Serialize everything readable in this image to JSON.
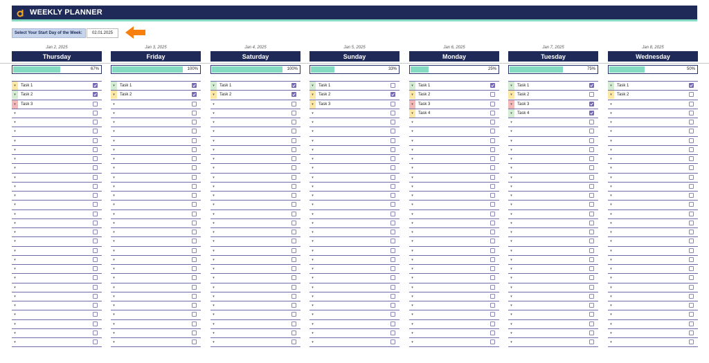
{
  "header": {
    "title": "WEEKLY PLANNER",
    "logo_icon": "d-logo-icon"
  },
  "start": {
    "label": "Select Your Start Day of the Week:",
    "value": "02.01.2025"
  },
  "colors": {
    "navy": "#1f2a58",
    "teal": "#85dac2",
    "check": "#7668b4",
    "high": "#f3b8b8",
    "medium": "#fde7a5",
    "low": "#d5ecd4"
  },
  "days": [
    {
      "date": "Jan 2, 2025",
      "name": "Thursday",
      "percent": "67%",
      "progress": 0.67,
      "tasks": [
        {
          "label": "Task 1",
          "prio": "medium",
          "done": true
        },
        {
          "label": "Task 2",
          "prio": "low",
          "done": true
        },
        {
          "label": "Task 3",
          "prio": "high",
          "done": false
        }
      ]
    },
    {
      "date": "Jan 3, 2025",
      "name": "Friday",
      "percent": "100%",
      "progress": 1.0,
      "tasks": [
        {
          "label": "Task 1",
          "prio": "low",
          "done": true
        },
        {
          "label": "Task 2",
          "prio": "medium",
          "done": true
        }
      ]
    },
    {
      "date": "Jan 4, 2025",
      "name": "Saturday",
      "percent": "100%",
      "progress": 1.0,
      "tasks": [
        {
          "label": "Task 1",
          "prio": "low",
          "done": true
        },
        {
          "label": "Task 2",
          "prio": "medium",
          "done": true
        }
      ]
    },
    {
      "date": "Jan 5, 2025",
      "name": "Sunday",
      "percent": "33%",
      "progress": 0.33,
      "tasks": [
        {
          "label": "Task 1",
          "prio": "low",
          "done": false
        },
        {
          "label": "Task 2",
          "prio": "medium",
          "done": true
        },
        {
          "label": "Task 3",
          "prio": "medium",
          "done": false
        }
      ]
    },
    {
      "date": "Jan 6, 2025",
      "name": "Monday",
      "percent": "25%",
      "progress": 0.25,
      "tasks": [
        {
          "label": "Task 1",
          "prio": "low",
          "done": true
        },
        {
          "label": "Task 2",
          "prio": "medium",
          "done": false
        },
        {
          "label": "Task 3",
          "prio": "high",
          "done": false
        },
        {
          "label": "Task 4",
          "prio": "medium",
          "done": false
        }
      ]
    },
    {
      "date": "Jan 7, 2025",
      "name": "Tuesday",
      "percent": "75%",
      "progress": 0.75,
      "tasks": [
        {
          "label": "Task 1",
          "prio": "low",
          "done": true
        },
        {
          "label": "Task 2",
          "prio": "medium",
          "done": false
        },
        {
          "label": "Task 3",
          "prio": "high",
          "done": true
        },
        {
          "label": "Task 4",
          "prio": "low",
          "done": true
        }
      ]
    },
    {
      "date": "Jan 8, 2025",
      "name": "Wednesday",
      "percent": "50%",
      "progress": 0.5,
      "tasks": [
        {
          "label": "Task 1",
          "prio": "low",
          "done": true
        },
        {
          "label": "Task 2",
          "prio": "medium",
          "done": false
        }
      ]
    }
  ]
}
